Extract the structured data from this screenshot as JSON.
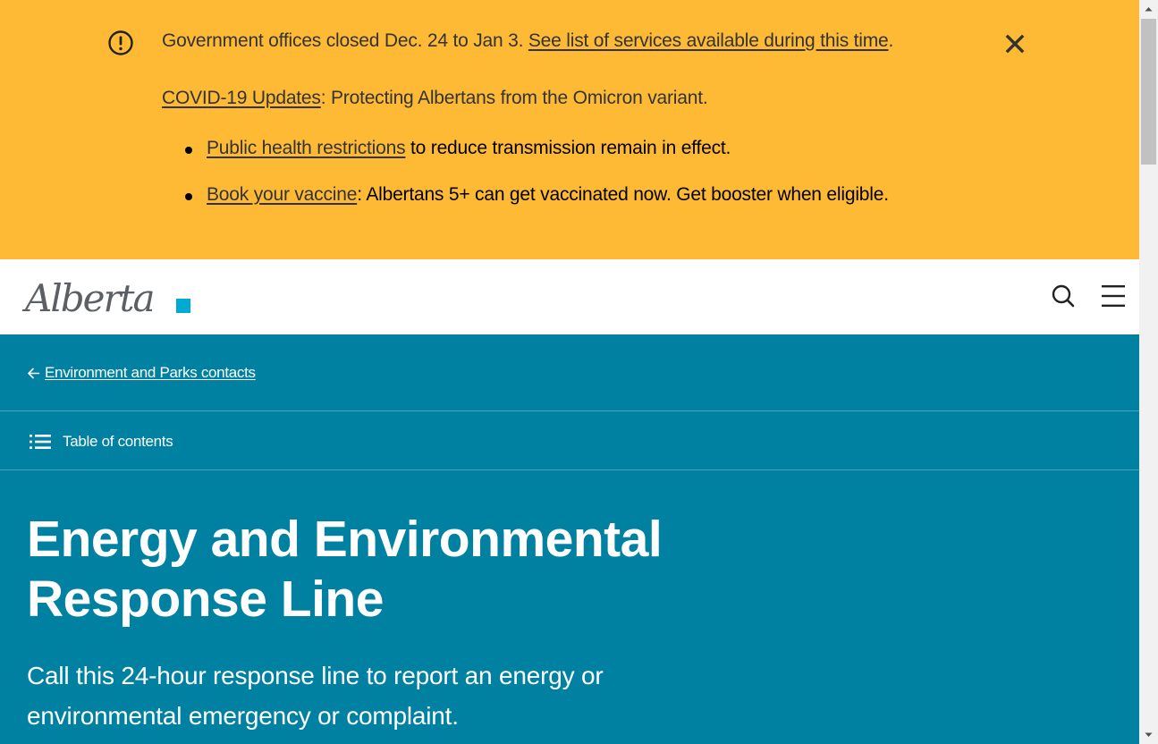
{
  "notice": {
    "alert_icon": "exclamation-circle-icon",
    "line1_text": "Government offices closed Dec. 24 to Jan 3.",
    "line1_link": "See list of services available during this time",
    "line1_end": ".",
    "line2_link": "COVID-19 Updates",
    "line2_text": ": Protecting Albertans from the Omicron variant.",
    "bullets": [
      {
        "link": "Public health restrictions",
        "text": " to reduce transmission remain in effect."
      },
      {
        "link": "Book your vaccine",
        "text": ": Albertans 5+ can get vaccinated now. Get booster when eligible."
      }
    ],
    "close_icon": "close-icon",
    "background": "#feba35"
  },
  "header": {
    "logo_text": "Alberta",
    "search_icon": "search-icon",
    "menu_icon": "hamburger-menu-icon"
  },
  "hero": {
    "back_link": "Environment and Parks contacts",
    "toc_label": "Table of contents",
    "title_line1": "Energy and Environmental",
    "title_line2": "Response Line",
    "lead_line1": "Call this 24-hour response line to report an energy or",
    "lead_line2": "environmental emergency or complaint.",
    "background": "#0081a2"
  }
}
